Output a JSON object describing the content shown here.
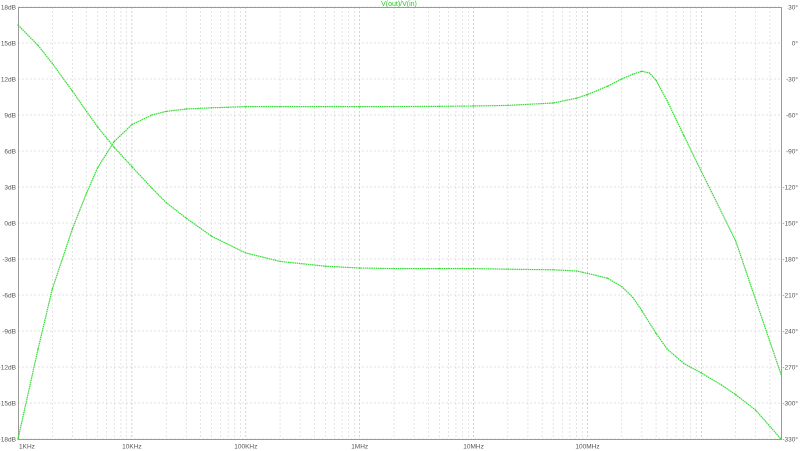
{
  "chart_data": {
    "type": "line",
    "title": "V(out)/V(in)",
    "x_scale": "log",
    "x_range_hz": [
      1000,
      5000000000
    ],
    "x_tick_labels": [
      {
        "label": "1KHz",
        "value": 1000
      },
      {
        "label": "10KHz",
        "value": 10000
      },
      {
        "label": "100KHz",
        "value": 100000
      },
      {
        "label": "1MHz",
        "value": 1000000
      },
      {
        "label": "10MHz",
        "value": 10000000
      },
      {
        "label": "100MHz",
        "value": 100000000
      }
    ],
    "y_left": {
      "unit": "dB",
      "range": [
        -18,
        18
      ],
      "ticks": [
        {
          "label": "18dB",
          "value": 18
        },
        {
          "label": "15dB",
          "value": 15
        },
        {
          "label": "12dB",
          "value": 12
        },
        {
          "label": "9dB",
          "value": 9
        },
        {
          "label": "6dB",
          "value": 6
        },
        {
          "label": "3dB",
          "value": 3
        },
        {
          "label": "0dB",
          "value": 0
        },
        {
          "label": "-3dB",
          "value": -3
        },
        {
          "label": "-6dB",
          "value": -6
        },
        {
          "label": "-9dB",
          "value": -9
        },
        {
          "label": "-12dB",
          "value": -12
        },
        {
          "label": "-15dB",
          "value": -15
        },
        {
          "label": "-18dB",
          "value": -18
        }
      ]
    },
    "y_right": {
      "unit": "°",
      "range": [
        -330,
        30
      ],
      "ticks": [
        {
          "label": "30°",
          "value": 30
        },
        {
          "label": "0°",
          "value": 0
        },
        {
          "label": "-30°",
          "value": -30
        },
        {
          "label": "-60°",
          "value": -60
        },
        {
          "label": "-90°",
          "value": -90
        },
        {
          "label": "-120°",
          "value": -120
        },
        {
          "label": "-150°",
          "value": -150
        },
        {
          "label": "-180°",
          "value": -180
        },
        {
          "label": "-210°",
          "value": -210
        },
        {
          "label": "-240°",
          "value": -240
        },
        {
          "label": "-270°",
          "value": -270
        },
        {
          "label": "-300°",
          "value": -300
        },
        {
          "label": "-330°",
          "value": -330
        }
      ]
    },
    "grid": true,
    "series_color": "#33dd33",
    "series": [
      {
        "axis": "left",
        "x": [
          1000,
          1500,
          2000,
          3000,
          4000,
          5000,
          7000,
          10000,
          15000,
          20000,
          30000,
          50000,
          70000,
          100000,
          200000,
          500000,
          1000000,
          2000000,
          5000000,
          10000000,
          20000000,
          50000000,
          80000000,
          100000000,
          150000000,
          200000000,
          250000000,
          300000000,
          350000000,
          400000000,
          500000000,
          700000000,
          1000000000,
          2000000000,
          5000000000
        ],
        "values": [
          -18,
          -10.5,
          -5.5,
          -0.5,
          2.5,
          4.6,
          6.8,
          8.2,
          9.0,
          9.3,
          9.5,
          9.6,
          9.65,
          9.7,
          9.7,
          9.7,
          9.7,
          9.7,
          9.72,
          9.75,
          9.8,
          10.0,
          10.4,
          10.7,
          11.4,
          12.0,
          12.4,
          12.65,
          12.5,
          11.9,
          10.2,
          7.3,
          4.3,
          -1.5,
          -12.6
        ]
      },
      {
        "axis": "right",
        "x": [
          1000,
          1500,
          2000,
          3000,
          4000,
          5000,
          7000,
          10000,
          15000,
          20000,
          30000,
          50000,
          100000,
          200000,
          500000,
          1000000,
          2000000,
          5000000,
          10000000,
          20000000,
          50000000,
          80000000,
          100000000,
          150000000,
          200000000,
          250000000,
          300000000,
          400000000,
          500000000,
          700000000,
          1000000000,
          1500000000,
          2000000000,
          3000000000,
          5000000000
        ],
        "values": [
          15,
          -2,
          -17,
          -40,
          -57,
          -70,
          -87,
          -103,
          -121,
          -133,
          -146,
          -161,
          -175,
          -182,
          -186,
          -187.5,
          -188,
          -188,
          -188,
          -188.5,
          -189,
          -190,
          -192,
          -196,
          -203,
          -212,
          -223,
          -242,
          -255,
          -267,
          -275,
          -285,
          -293,
          -306,
          -330
        ]
      }
    ]
  }
}
